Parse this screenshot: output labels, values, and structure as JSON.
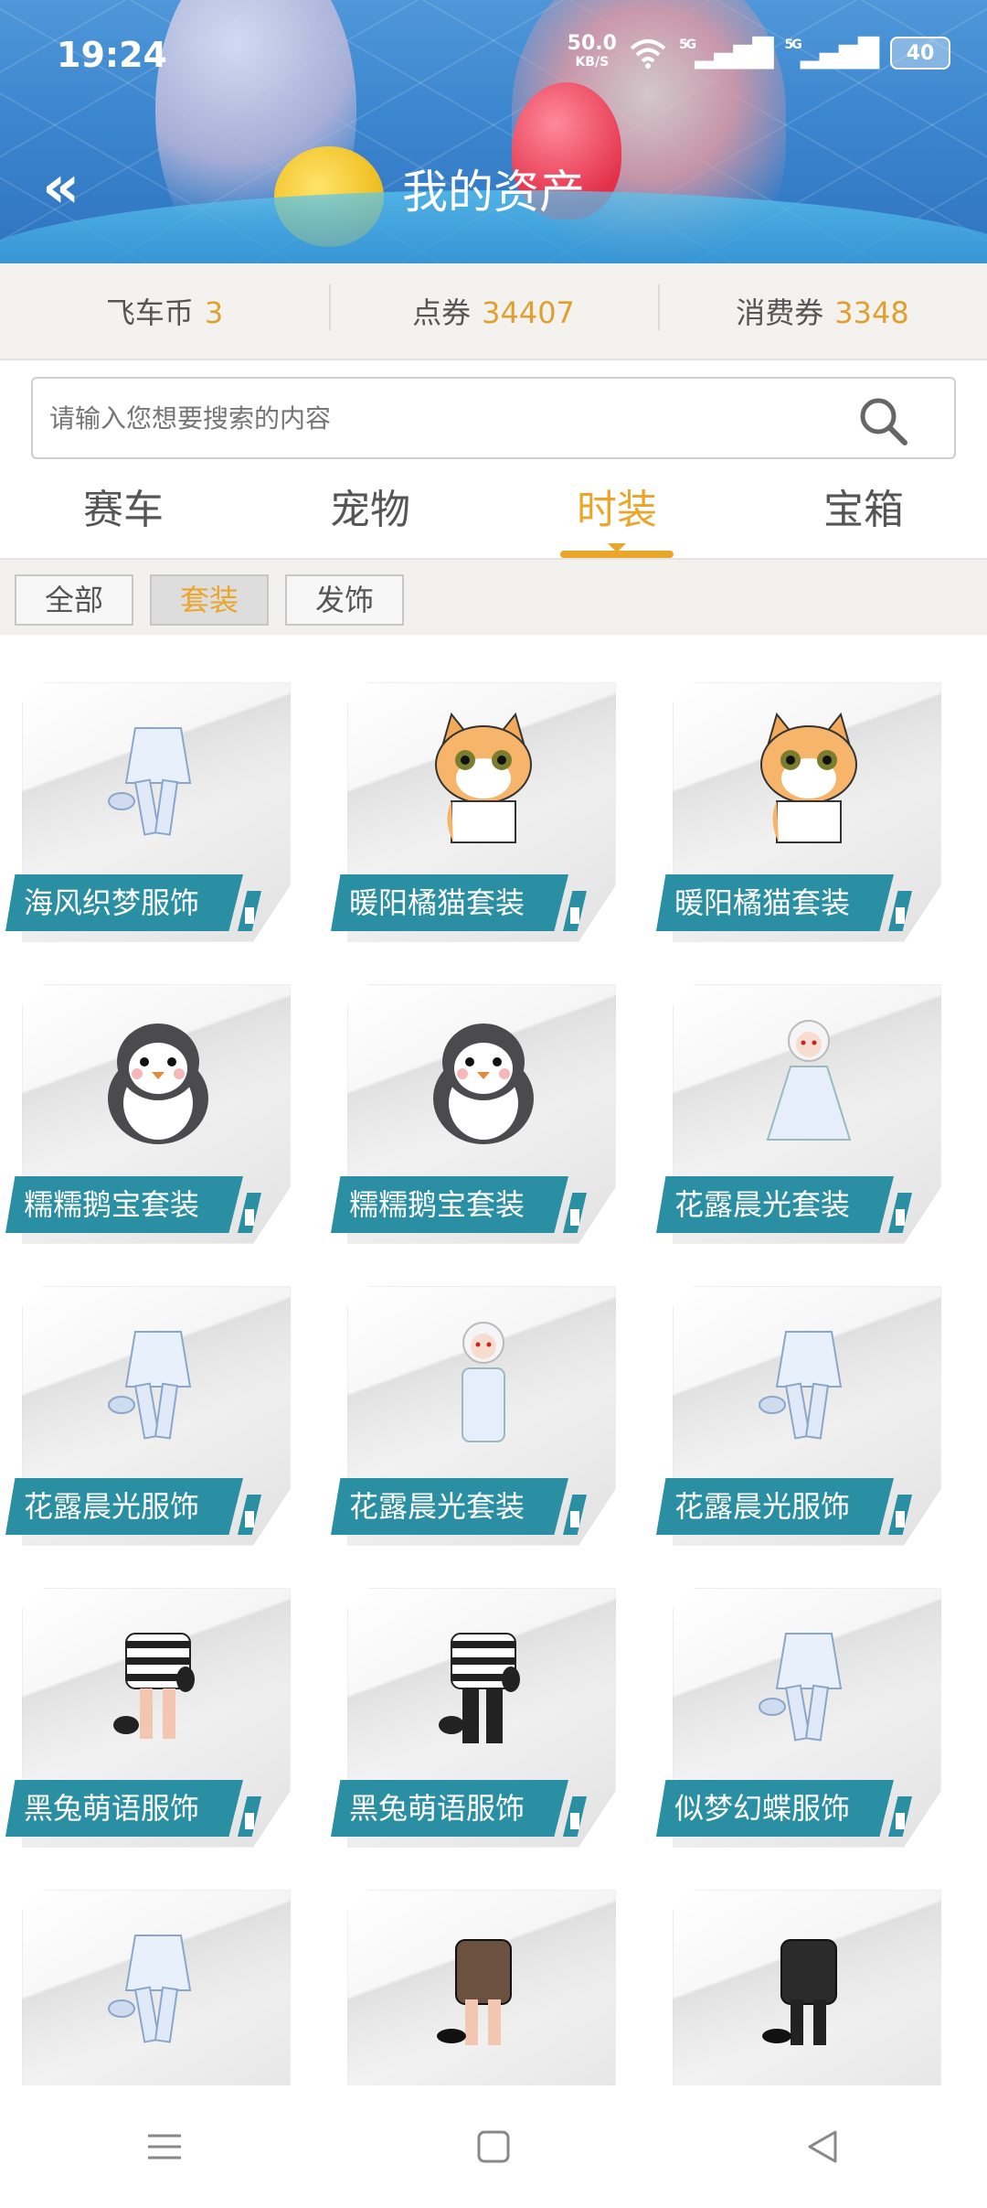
{
  "status": {
    "time": "19:24",
    "net_speed": "50.0",
    "net_unit": "KB/S",
    "sig1": "5G",
    "sig2": "5G",
    "battery": "40"
  },
  "header": {
    "title": "我的资产",
    "back_icon": "double-chevron-left-icon"
  },
  "currency": [
    {
      "label": "飞车币",
      "value": "3"
    },
    {
      "label": "点券",
      "value": "34407"
    },
    {
      "label": "消费券",
      "value": "3348"
    }
  ],
  "search": {
    "placeholder": "请输入您想要搜索的内容"
  },
  "tabs": [
    {
      "label": "赛车",
      "active": false
    },
    {
      "label": "宠物",
      "active": false
    },
    {
      "label": "时装",
      "active": true
    },
    {
      "label": "宝箱",
      "active": false
    }
  ],
  "filters": [
    {
      "label": "全部",
      "active": false
    },
    {
      "label": "套装",
      "active": true
    },
    {
      "label": "发饰",
      "active": false
    }
  ],
  "items": [
    {
      "name": "海风织梦服饰",
      "art": "outfit-blue"
    },
    {
      "name": "暖阳橘猫套装",
      "art": "cat"
    },
    {
      "name": "暖阳橘猫套装",
      "art": "cat"
    },
    {
      "name": "糯糯鹅宝套装",
      "art": "penguin"
    },
    {
      "name": "糯糯鹅宝套装",
      "art": "penguin"
    },
    {
      "name": "花露晨光套装",
      "art": "figure-white-dress"
    },
    {
      "name": "花露晨光服饰",
      "art": "outfit-white-dress"
    },
    {
      "name": "花露晨光套装",
      "art": "figure-white-suit"
    },
    {
      "name": "花露晨光服饰",
      "art": "outfit-white-suit"
    },
    {
      "name": "黑兔萌语服饰",
      "art": "outfit-striped"
    },
    {
      "name": "黑兔萌语服饰",
      "art": "outfit-striped-pants"
    },
    {
      "name": "似梦幻蝶服饰",
      "art": "outfit-white-gown"
    },
    {
      "name": "",
      "art": "outfit-white-long"
    },
    {
      "name": "",
      "art": "outfit-black-lace"
    },
    {
      "name": "",
      "art": "outfit-black-suit"
    }
  ],
  "colors": {
    "accent": "#e9a62b",
    "label_bg": "#2b8fa4"
  }
}
